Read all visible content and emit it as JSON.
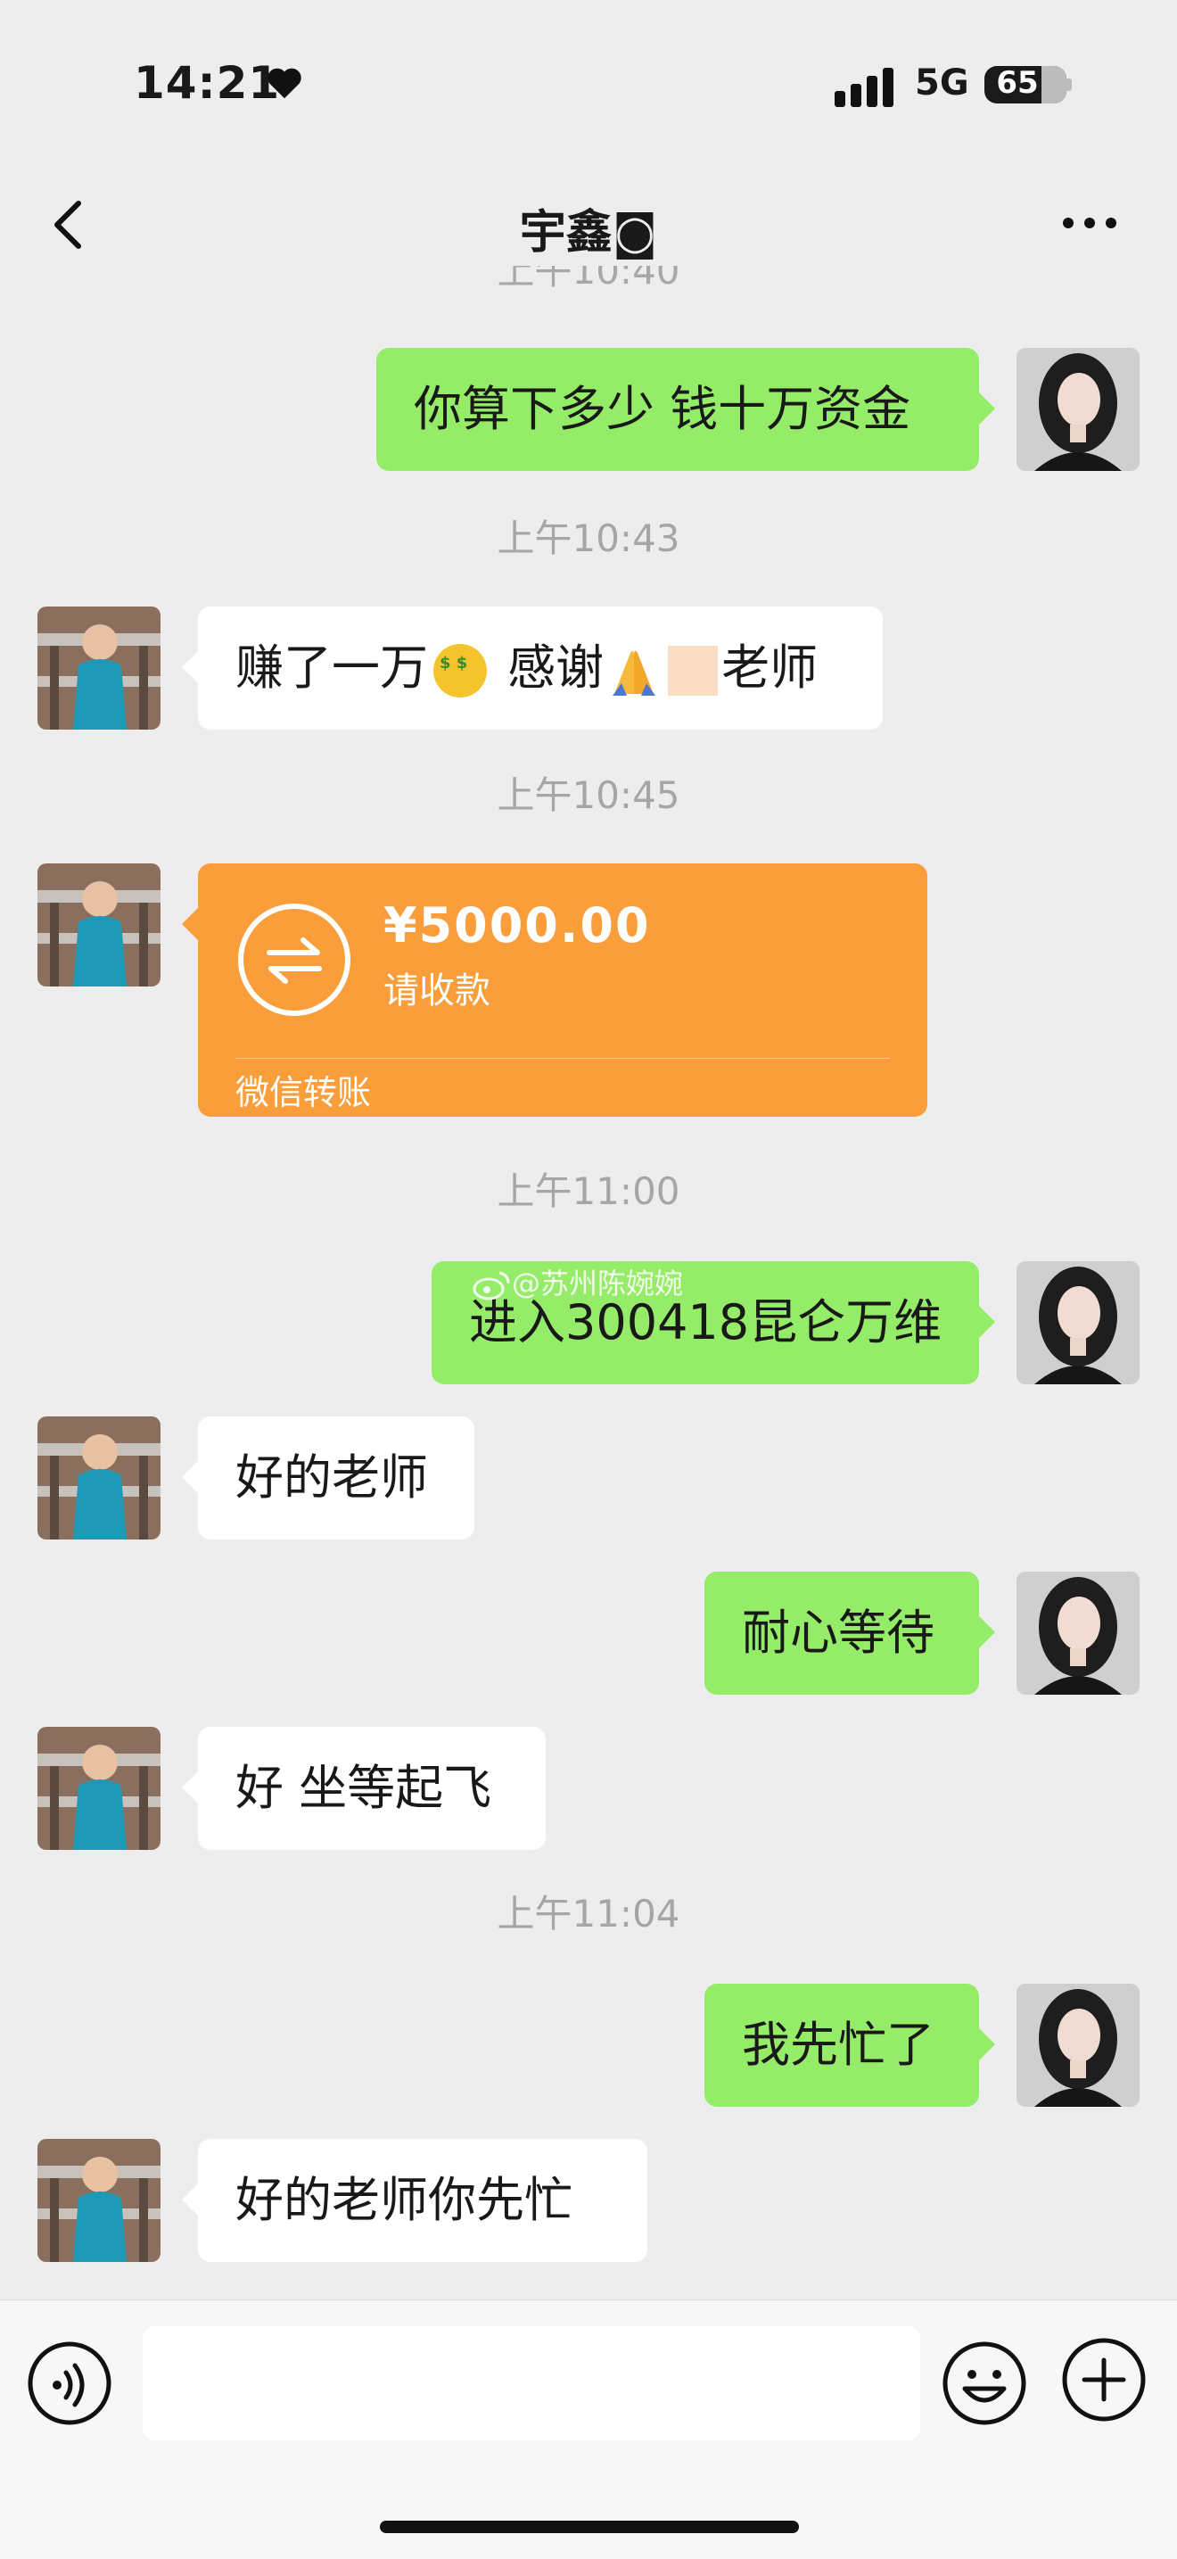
{
  "status_bar": {
    "time": "14:21",
    "network": "5G",
    "battery": "65"
  },
  "header": {
    "title": "宇鑫",
    "title_symbol": "◙"
  },
  "peek_time": "上午10:40",
  "messages": [
    {
      "side": "out",
      "text": "你算下多少  钱十万资金"
    },
    {
      "time": "上午10:43"
    },
    {
      "side": "in",
      "text_a": "赚了一万",
      "text_b": "  感谢",
      "text_c": "老师",
      "emoji": [
        "money-mouth-emoji",
        "folded-hands-emoji",
        "skin-tone-square"
      ]
    },
    {
      "time": "上午10:45"
    },
    {
      "side": "in",
      "type": "transfer",
      "amount": "¥5000.00",
      "status": "请收款",
      "brand": "微信转账"
    },
    {
      "time": "上午11:00"
    },
    {
      "side": "out",
      "text": "进入300418昆仑万维"
    },
    {
      "side": "in",
      "text": "好的老师"
    },
    {
      "side": "out",
      "text": "耐心等待"
    },
    {
      "side": "in",
      "text": "好  坐等起飞"
    },
    {
      "time": "上午11:04"
    },
    {
      "side": "out",
      "text": "我先忙了"
    },
    {
      "side": "in",
      "text": "好的老师你先忙"
    }
  ],
  "watermark": "@苏州陈婉婉",
  "input": {
    "placeholder": ""
  },
  "colors": {
    "outgoing_bubble": "#95ec69",
    "incoming_bubble": "#ffffff",
    "transfer": "#fa9d3b",
    "background": "#ededed"
  }
}
